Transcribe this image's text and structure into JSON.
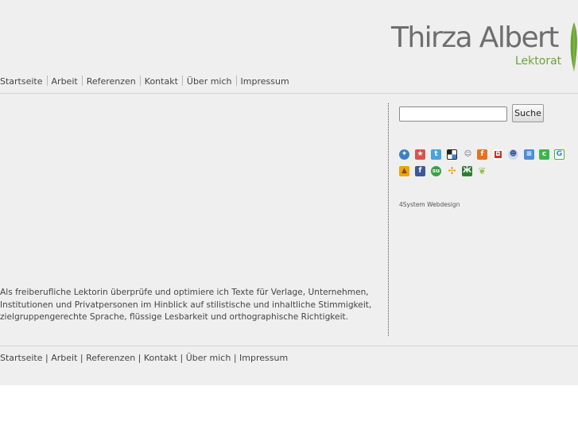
{
  "brand": {
    "name": "Thirza Albert",
    "subtitle": "Lektorat"
  },
  "nav": [
    {
      "label": "Startseite"
    },
    {
      "label": "Arbeit"
    },
    {
      "label": "Referenzen"
    },
    {
      "label": "Kontakt"
    },
    {
      "label": "Über mich"
    },
    {
      "label": "Impressum"
    }
  ],
  "main": {
    "intro": "Als freiberufliche Lektorin überprüfe und optimiere ich Texte für Verlage, Unternehmen, Institutionen und Privatpersonen im Hinblick auf stilistische und inhaltliche Stimmigkeit, zielgruppengerechte Sprache, flüssige Lesbarkeit und orthographische Richtigkeit."
  },
  "sidebar": {
    "search_value": "",
    "search_button": "Suche",
    "share_icons": [
      {
        "name": "blinklist-icon",
        "color": "#3b82c4"
      },
      {
        "name": "bookmark-star-icon",
        "color": "#d9534f"
      },
      {
        "name": "twitter-icon",
        "color": "#4aa3df"
      },
      {
        "name": "delicious-icon",
        "color": "#222222"
      },
      {
        "name": "people-icon",
        "color": "#888888"
      },
      {
        "name": "misterwong-icon",
        "color": "#e8711c"
      },
      {
        "name": "newsvine-icon",
        "color": "#c0392b"
      },
      {
        "name": "reddit-icon",
        "color": "#6a8ec7"
      },
      {
        "name": "document-icon",
        "color": "#4b8ed9"
      },
      {
        "name": "technorati-icon",
        "color": "#3cb54a"
      },
      {
        "name": "google-icon",
        "color": "#3b7bd6"
      },
      {
        "name": "upload-icon",
        "color": "#f0a30a"
      },
      {
        "name": "facebook-icon",
        "color": "#3b5998"
      },
      {
        "name": "stumbleupon-icon",
        "color": "#3a9f48"
      },
      {
        "name": "slashdot-icon",
        "color": "#f0a30a"
      },
      {
        "name": "yigg-icon",
        "color": "#2f7d32"
      },
      {
        "name": "leaf-icon",
        "color": "#8bc34a"
      }
    ],
    "credit": "4System Webdesign"
  }
}
